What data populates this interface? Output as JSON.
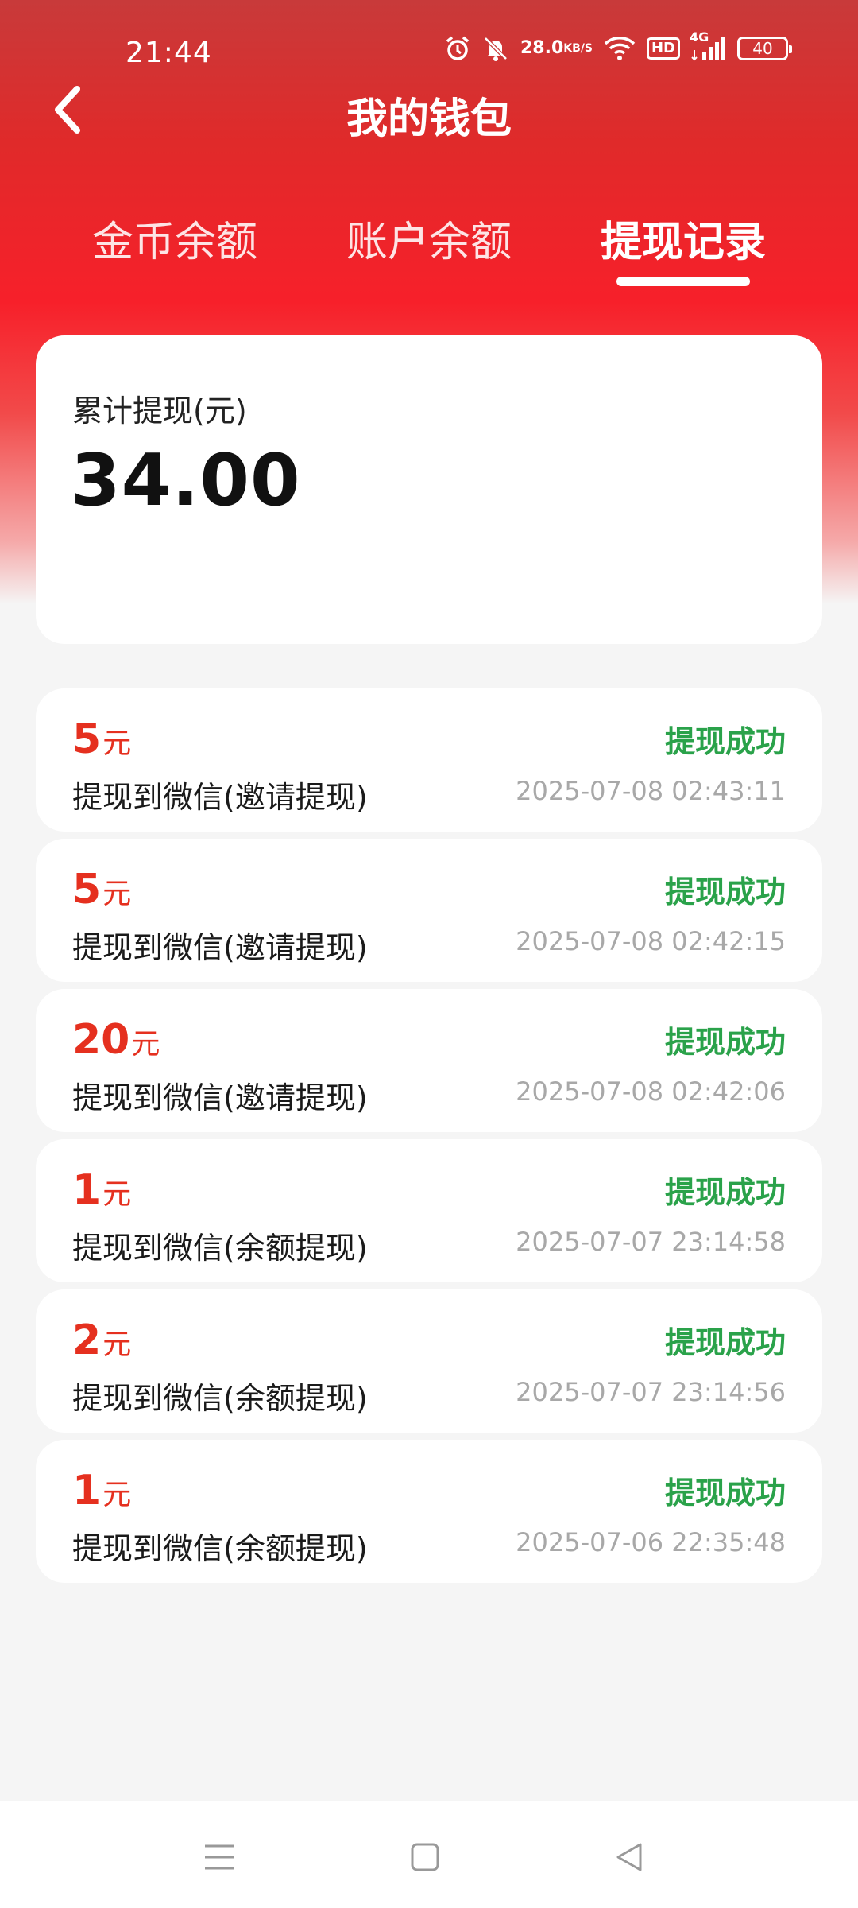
{
  "status_bar": {
    "time": "21:44",
    "net_speed_value": "28.0",
    "net_speed_unit": "KB/S",
    "hd": "HD",
    "network": "4G",
    "battery": "40",
    "icons": [
      "alarm-icon",
      "mute-icon",
      "wifi-icon",
      "signal-icon",
      "battery-icon"
    ]
  },
  "header": {
    "title": "我的钱包",
    "back_icon": "chevron-left-icon"
  },
  "tabs": [
    {
      "label": "金币余额",
      "active": false
    },
    {
      "label": "账户余额",
      "active": false
    },
    {
      "label": "提现记录",
      "active": true
    }
  ],
  "summary": {
    "label": "累计提现(元)",
    "amount": "34.00"
  },
  "records": [
    {
      "amount": "5",
      "unit": "元",
      "desc": "提现到微信(邀请提现)",
      "status": "提现成功",
      "time": "2025-07-08 02:43:11"
    },
    {
      "amount": "5",
      "unit": "元",
      "desc": "提现到微信(邀请提现)",
      "status": "提现成功",
      "time": "2025-07-08 02:42:15"
    },
    {
      "amount": "20",
      "unit": "元",
      "desc": "提现到微信(邀请提现)",
      "status": "提现成功",
      "time": "2025-07-08 02:42:06"
    },
    {
      "amount": "1",
      "unit": "元",
      "desc": "提现到微信(余额提现)",
      "status": "提现成功",
      "time": "2025-07-07 23:14:58"
    },
    {
      "amount": "2",
      "unit": "元",
      "desc": "提现到微信(余额提现)",
      "status": "提现成功",
      "time": "2025-07-07 23:14:56"
    },
    {
      "amount": "1",
      "unit": "元",
      "desc": "提现到微信(余额提现)",
      "status": "提现成功",
      "time": "2025-07-06 22:35:48"
    }
  ],
  "colors": {
    "brand_red": "#e02a2a",
    "amount_red": "#e5301f",
    "success_green": "#2aa24a",
    "time_gray": "#a8a8a8"
  },
  "nav_bar": {
    "icons": [
      "menu-icon",
      "home-square-icon",
      "back-triangle-icon"
    ]
  }
}
